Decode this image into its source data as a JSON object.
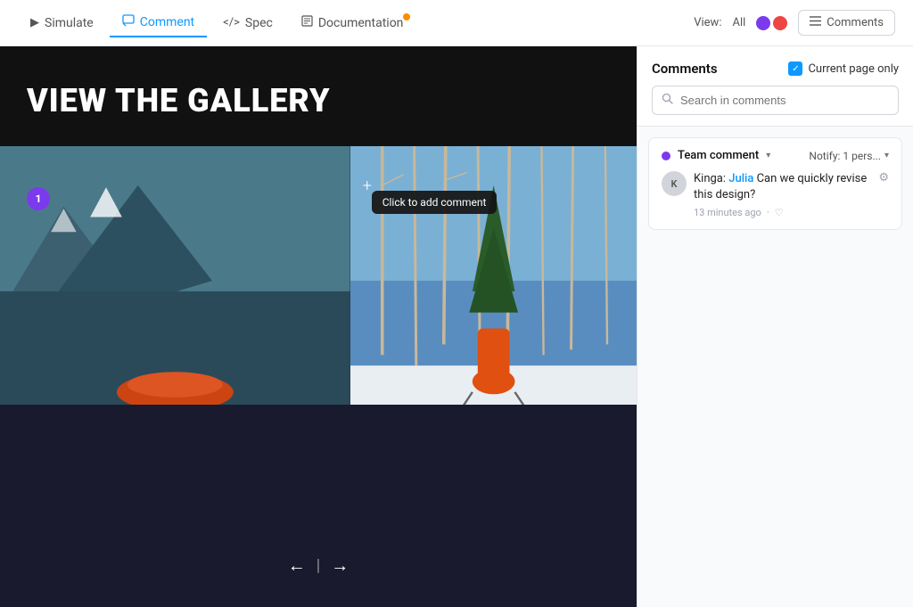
{
  "topbar": {
    "nav_items": [
      {
        "id": "simulate",
        "label": "Simulate",
        "icon": "▶",
        "active": false,
        "badge": false
      },
      {
        "id": "comment",
        "label": "Comment",
        "icon": "☰",
        "active": true,
        "badge": false
      },
      {
        "id": "spec",
        "label": "Spec",
        "icon": "</>",
        "active": false,
        "badge": false
      },
      {
        "id": "documentation",
        "label": "Documentation",
        "icon": "☰",
        "active": false,
        "badge": true
      }
    ],
    "view_label": "View:",
    "view_all": "All",
    "comments_btn_label": "Comments"
  },
  "canvas": {
    "gallery_title": "VIEW THE GALLERY",
    "pin_number": "1",
    "nav_prev": "←",
    "nav_next": "→",
    "tooltip": "Click to add comment"
  },
  "comments_panel": {
    "title": "Comments",
    "current_page_label": "Current page only",
    "search_placeholder": "Search in comments",
    "thread": {
      "team_label": "Team comment",
      "notify_label": "Notify: 1 pers...",
      "comment": {
        "author": "Kinga:",
        "mention": "Julia",
        "text": " Can we quickly revise this design?",
        "time": "13 minutes ago",
        "avatar_initial": "K"
      }
    }
  }
}
